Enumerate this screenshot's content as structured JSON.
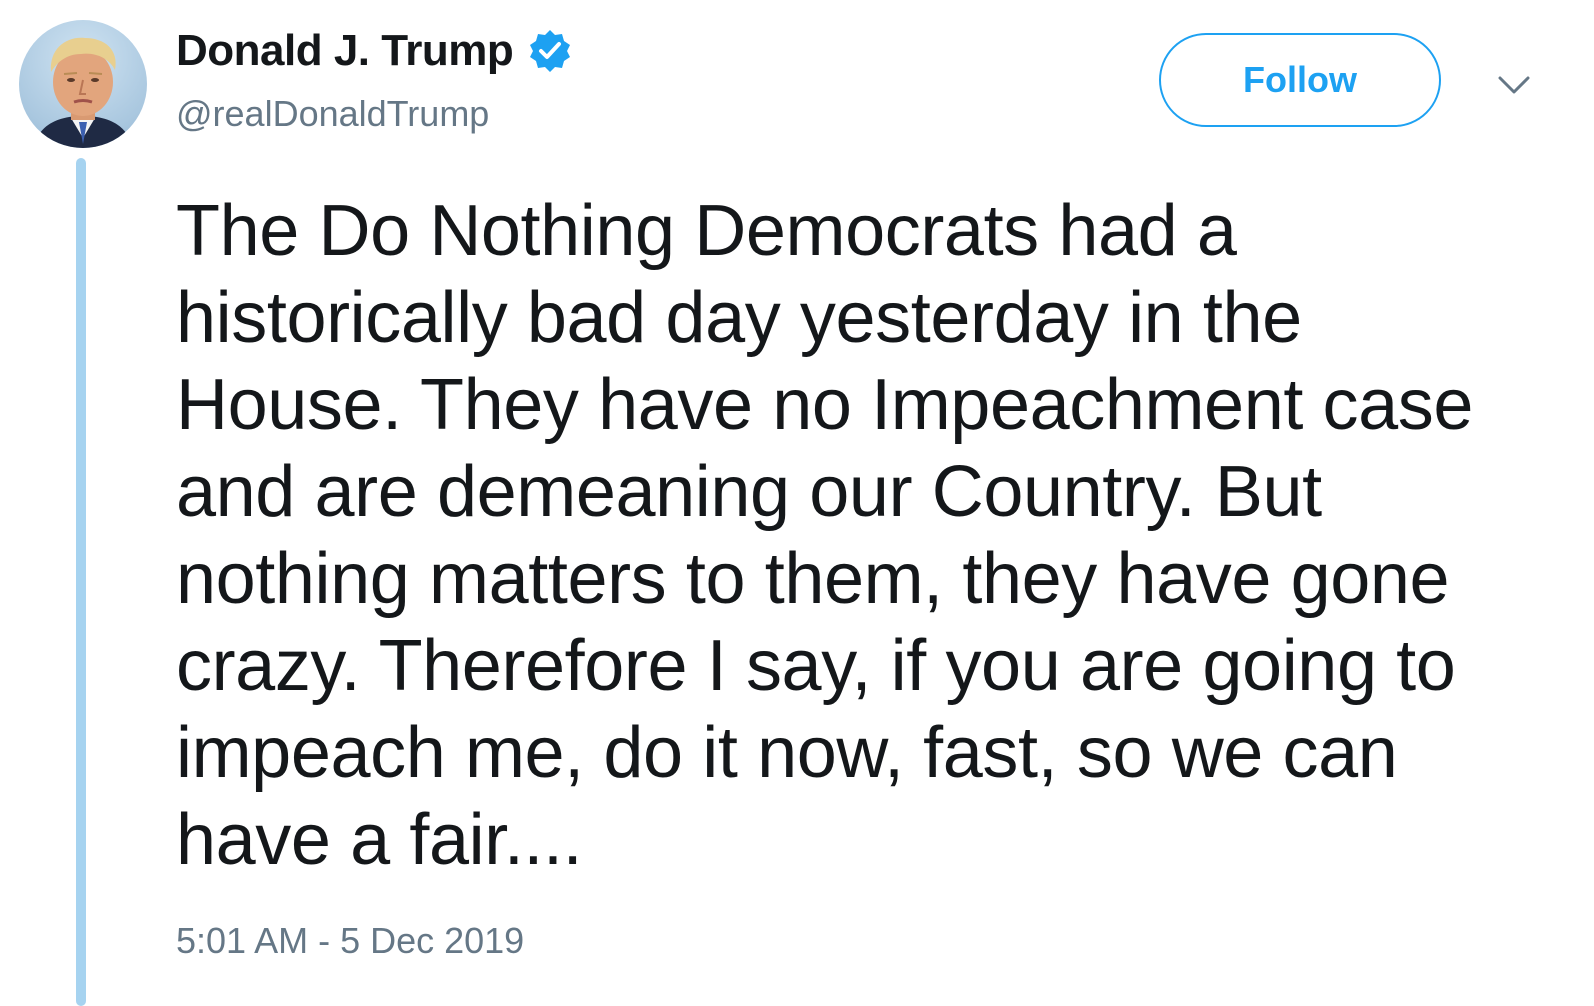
{
  "author": {
    "display_name": "Donald J. Trump",
    "handle": "@realDonaldTrump",
    "verified": true,
    "verified_icon": "verified-badge-icon",
    "avatar_icon": "profile-avatar"
  },
  "actions": {
    "follow_label": "Follow",
    "menu_icon": "chevron-down-icon"
  },
  "tweet": {
    "lines": [
      "The Do Nothing Democrats had a",
      "historically bad day yesterday in the",
      "House. They have no Impeachment case",
      "and are demeaning our Country. But",
      "nothing matters to them, they have gone",
      "crazy. Therefore I say, if you are going to",
      "impeach me, do it now, fast, so we can",
      "have a fair...."
    ],
    "timestamp": "5:01 AM - 5 Dec 2019"
  },
  "colors": {
    "accent": "#1da1f2",
    "text": "#14171a",
    "secondary_text": "#657786",
    "thread_line": "#a6d3f0"
  }
}
